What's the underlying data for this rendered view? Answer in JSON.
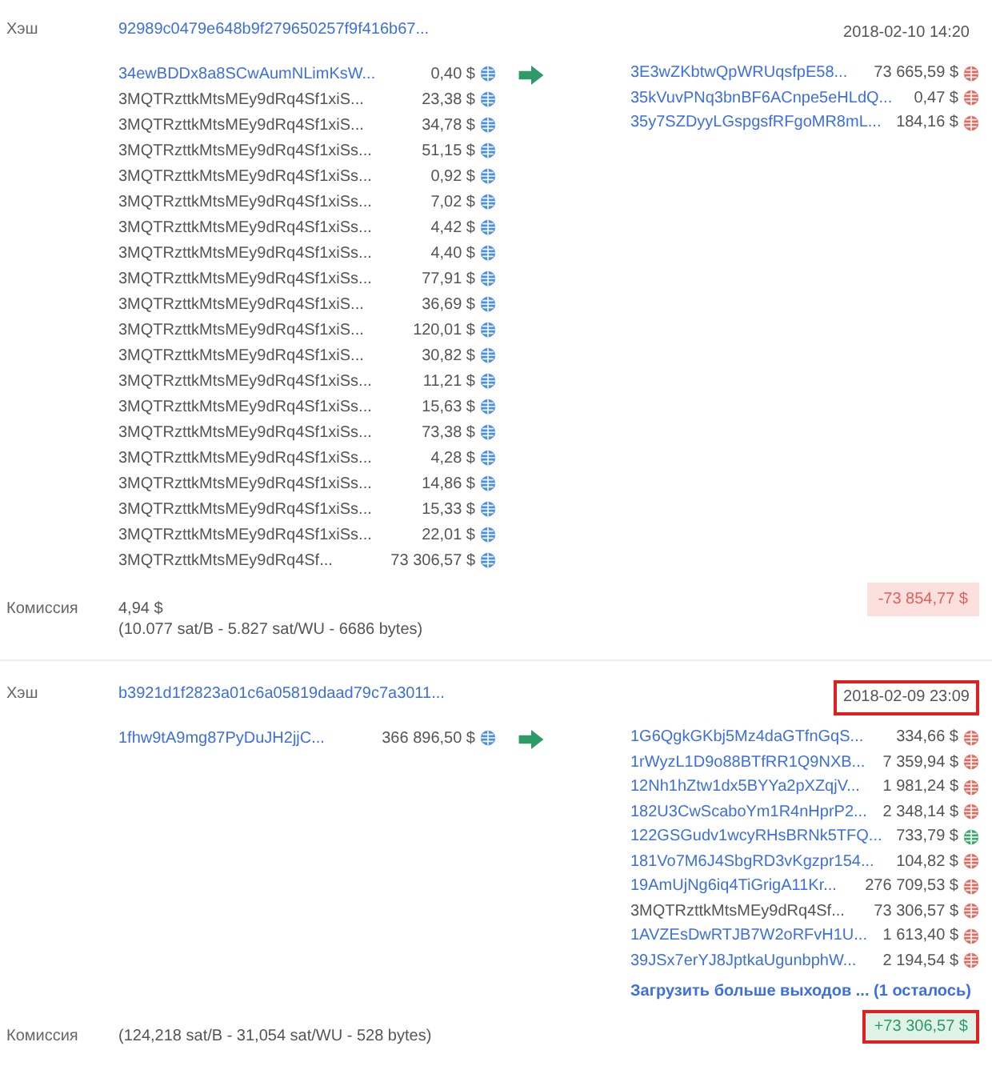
{
  "transactions": [
    {
      "hash_label": "Хэш",
      "hash": "92989c0479e648b9f279650257f9f416b67...",
      "date": "2018-02-10 14:20",
      "date_highlighted": false,
      "inputs": [
        {
          "address": "34ewBDDx8a8SCwAumNLimKsW...",
          "linked": true,
          "amount": "0,40 $",
          "color": "#4a8fe7"
        },
        {
          "address": "3MQTRzttkMtsMEy9dRq4Sf1xiS...",
          "linked": false,
          "amount": "23,38 $",
          "color": "#4a8fe7"
        },
        {
          "address": "3MQTRzttkMtsMEy9dRq4Sf1xiS...",
          "linked": false,
          "amount": "34,78 $",
          "color": "#4a8fe7"
        },
        {
          "address": "3MQTRzttkMtsMEy9dRq4Sf1xiSs...",
          "linked": false,
          "amount": "51,15 $",
          "color": "#4a8fe7"
        },
        {
          "address": "3MQTRzttkMtsMEy9dRq4Sf1xiSs...",
          "linked": false,
          "amount": "0,92 $",
          "color": "#4a8fe7"
        },
        {
          "address": "3MQTRzttkMtsMEy9dRq4Sf1xiSs...",
          "linked": false,
          "amount": "7,02 $",
          "color": "#4a8fe7"
        },
        {
          "address": "3MQTRzttkMtsMEy9dRq4Sf1xiSs...",
          "linked": false,
          "amount": "4,42 $",
          "color": "#4a8fe7"
        },
        {
          "address": "3MQTRzttkMtsMEy9dRq4Sf1xiSs...",
          "linked": false,
          "amount": "4,40 $",
          "color": "#4a8fe7"
        },
        {
          "address": "3MQTRzttkMtsMEy9dRq4Sf1xiSs...",
          "linked": false,
          "amount": "77,91 $",
          "color": "#4a8fe7"
        },
        {
          "address": "3MQTRzttkMtsMEy9dRq4Sf1xiS...",
          "linked": false,
          "amount": "36,69 $",
          "color": "#4a8fe7"
        },
        {
          "address": "3MQTRzttkMtsMEy9dRq4Sf1xiS...",
          "linked": false,
          "amount": "120,01 $",
          "color": "#4a8fe7"
        },
        {
          "address": "3MQTRzttkMtsMEy9dRq4Sf1xiS...",
          "linked": false,
          "amount": "30,82 $",
          "color": "#4a8fe7"
        },
        {
          "address": "3MQTRzttkMtsMEy9dRq4Sf1xiSs...",
          "linked": false,
          "amount": "11,21 $",
          "color": "#4a8fe7"
        },
        {
          "address": "3MQTRzttkMtsMEy9dRq4Sf1xiSs...",
          "linked": false,
          "amount": "15,63 $",
          "color": "#4a8fe7"
        },
        {
          "address": "3MQTRzttkMtsMEy9dRq4Sf1xiSs...",
          "linked": false,
          "amount": "73,38 $",
          "color": "#4a8fe7"
        },
        {
          "address": "3MQTRzttkMtsMEy9dRq4Sf1xiSs...",
          "linked": false,
          "amount": "4,28 $",
          "color": "#4a8fe7"
        },
        {
          "address": "3MQTRzttkMtsMEy9dRq4Sf1xiSs...",
          "linked": false,
          "amount": "14,86 $",
          "color": "#4a8fe7"
        },
        {
          "address": "3MQTRzttkMtsMEy9dRq4Sf1xiSs...",
          "linked": false,
          "amount": "15,33 $",
          "color": "#4a8fe7"
        },
        {
          "address": "3MQTRzttkMtsMEy9dRq4Sf1xiSs...",
          "linked": false,
          "amount": "22,01 $",
          "color": "#4a8fe7"
        },
        {
          "address": "3MQTRzttkMtsMEy9dRq4Sf...",
          "linked": false,
          "amount": "73 306,57 $",
          "color": "#4a8fe7"
        }
      ],
      "outputs": [
        {
          "address": "3E3wZKbtwQpWRUqsfpE58...",
          "linked": true,
          "amount": "73 665,59 $",
          "color": "#e8675a"
        },
        {
          "address": "35kVuvPNq3bnBF6ACnpe5eHLdQ...",
          "linked": true,
          "amount": "0,47 $",
          "color": "#e8675a"
        },
        {
          "address": "35y7SZDyyLGspgsfRFgoMR8mL...",
          "linked": true,
          "amount": "184,16 $",
          "color": "#e8675a"
        }
      ],
      "fee_label": "Комиссия",
      "fee": "4,94 $",
      "fee_detail": "(10.077 sat/B - 5.827 sat/WU - 6686 bytes)",
      "total": "-73 854,77 $",
      "total_negative": true,
      "total_highlighted": false
    },
    {
      "hash_label": "Хэш",
      "hash": "b3921d1f2823a01c6a05819daad79c7a3011...",
      "date": "2018-02-09 23:09",
      "date_highlighted": true,
      "inputs": [
        {
          "address": "1fhw9tA9mg87PyDuJH2jjC...",
          "linked": true,
          "amount": "366 896,50 $",
          "color": "#4a8fe7"
        }
      ],
      "outputs": [
        {
          "address": "1G6QgkGKbj5Mz4daGTfnGqS...",
          "linked": true,
          "amount": "334,66 $",
          "color": "#e8675a"
        },
        {
          "address": "1rWyzL1D9o88BTfRR1Q9NXB...",
          "linked": true,
          "amount": "7 359,94 $",
          "color": "#e8675a"
        },
        {
          "address": "12Nh1hZtw1dx5BYYa2pXZqjV...",
          "linked": true,
          "amount": "1 981,24 $",
          "color": "#e8675a"
        },
        {
          "address": "182U3CwScaboYm1R4nHprP2...",
          "linked": true,
          "amount": "2 348,14 $",
          "color": "#e8675a"
        },
        {
          "address": "122GSGudv1wcyRHsBRNk5TFQ...",
          "linked": true,
          "amount": "733,79 $",
          "color": "#3aa76d"
        },
        {
          "address": "181Vo7M6J4SbgRD3vKgzpr154...",
          "linked": true,
          "amount": "104,82 $",
          "color": "#e8675a"
        },
        {
          "address": "19AmUjNg6iq4TiGrigA11Kr...",
          "linked": true,
          "amount": "276 709,53 $",
          "color": "#e8675a"
        },
        {
          "address": "3MQTRzttkMtsMEy9dRq4Sf...",
          "linked": false,
          "amount": "73 306,57 $",
          "color": "#e8675a"
        },
        {
          "address": "1AVZEsDwRTJB7W2oRFvH1U...",
          "linked": true,
          "amount": "1 613,40 $",
          "color": "#e8675a"
        },
        {
          "address": "39JSx7erYJ8JptkaUgunbphW...",
          "linked": true,
          "amount": "2 194,54 $",
          "color": "#e8675a"
        }
      ],
      "load_more": "Загрузить больше выходов ... (1 осталось)",
      "fee_label": "Комиссия",
      "fee_detail": "(124,218 sat/B - 31,054 sat/WU - 528 bytes)",
      "total": "+73 306,57 $",
      "total_negative": false,
      "total_highlighted": true
    }
  ]
}
